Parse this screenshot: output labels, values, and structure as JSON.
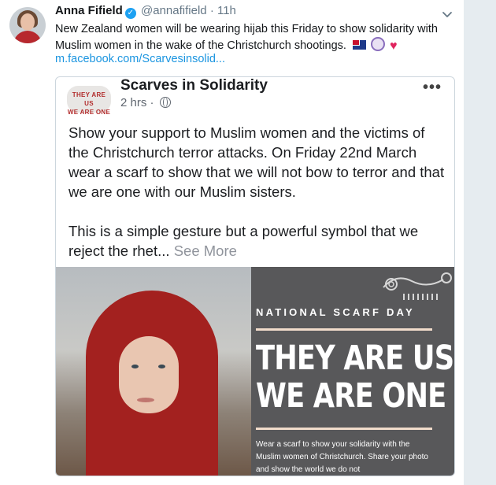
{
  "tweet": {
    "author_name": "Anna Fifield",
    "handle": "@annafifield",
    "separator": "·",
    "time": "11h",
    "text": "New Zealand women will be wearing hijab this Friday to show solidarity with Muslim women in the wake of the Christchurch shootings.",
    "link": "m.facebook.com/Scarvesinsolid...",
    "emojis": [
      "new-zealand-flag",
      "woman-with-headscarf",
      "red-heart"
    ]
  },
  "card": {
    "logo_line1": "THEY ARE US",
    "logo_line2": "WE ARE ONE",
    "page_name": "Scarves in Solidarity",
    "posted": "2 hrs",
    "meta_sep": "·",
    "paragraph1": "Show your support to Muslim women and the victims of the Christchurch terror attacks.  On Friday 22nd March wear a scarf to show that we will not bow to terror and that we are one with our Muslim sisters.",
    "paragraph2": "This is a simple gesture but a powerful symbol that we reject the rhet...",
    "see_more": "See More",
    "image": {
      "heading": "NATIONAL SCARF DAY",
      "big_line1": "THEY ARE US",
      "big_line2": "WE ARE ONE",
      "caption": "Wear a scarf to show your solidarity with the Muslim women of Christchurch. Share your photo and show the world we do not"
    }
  },
  "colors": {
    "link": "#1b95e0",
    "verified": "#1da1f2",
    "panel": "#58585a",
    "scarf": "#a3211f",
    "heart": "#e0245e"
  }
}
